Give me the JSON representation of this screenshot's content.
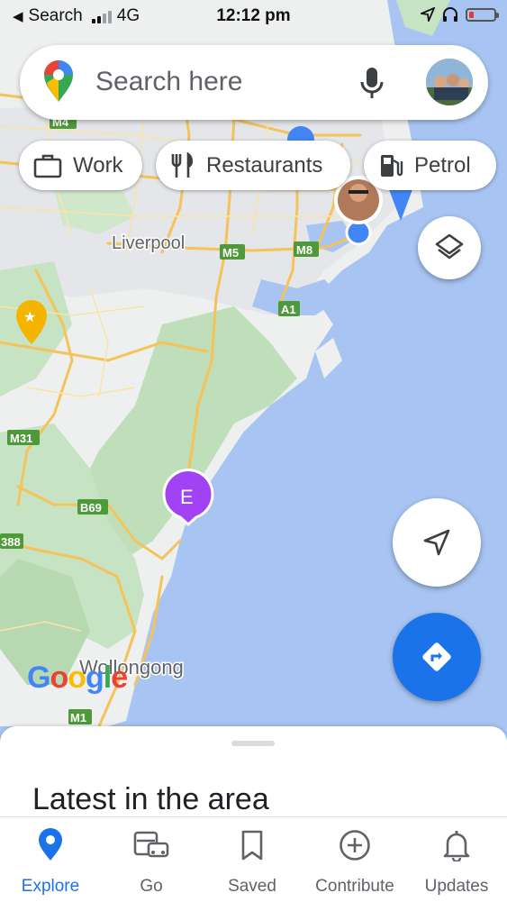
{
  "status_bar": {
    "back_app": "Search",
    "network": "4G",
    "time": "12:12 pm"
  },
  "search": {
    "placeholder": "Search here"
  },
  "chips": [
    {
      "label": "Work",
      "icon": "briefcase-icon"
    },
    {
      "label": "Restaurants",
      "icon": "fork-knife-icon"
    },
    {
      "label": "Petrol",
      "icon": "fuel-pump-icon"
    }
  ],
  "map": {
    "place_labels": [
      "Liverpool",
      "Wollongong"
    ],
    "road_labels": [
      "M4",
      "M5",
      "M8",
      "A1",
      "M31",
      "B69",
      "388",
      "M1"
    ],
    "marker_letter": "E",
    "attribution": "Google"
  },
  "sheet": {
    "title": "Latest in the area"
  },
  "nav": {
    "items": [
      {
        "label": "Explore",
        "icon": "location-pin-icon",
        "active": true
      },
      {
        "label": "Go",
        "icon": "car-bus-icon"
      },
      {
        "label": "Saved",
        "icon": "bookmark-icon"
      },
      {
        "label": "Contribute",
        "icon": "plus-circle-icon"
      },
      {
        "label": "Updates",
        "icon": "bell-icon"
      }
    ]
  },
  "colors": {
    "accent": "#1a73e8",
    "water": "#a7c4f2",
    "land": "#f1f3f4",
    "park": "#c8e6c9",
    "road": "#fbd06a",
    "marker_purple": "#a142f4"
  }
}
